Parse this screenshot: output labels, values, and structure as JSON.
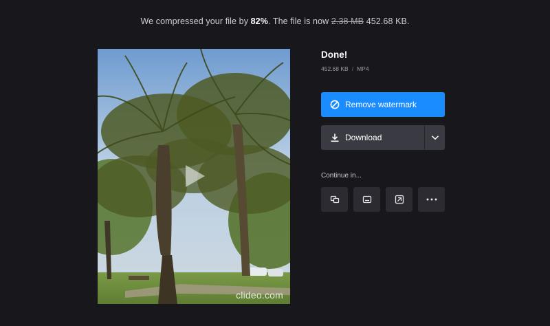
{
  "summary": {
    "prefix": "We compressed your file by ",
    "percent": "82%",
    "middle": ". The file is now ",
    "original_size": "2.38 MB",
    "new_size": "452.68 KB."
  },
  "preview": {
    "watermark": "clideo.com",
    "play_icon": "play-icon"
  },
  "result": {
    "title": "Done!",
    "size": "452.68 KB",
    "separator": "/",
    "format": "MP4"
  },
  "actions": {
    "remove_watermark_label": "Remove watermark",
    "remove_watermark_icon": "no-watermark-icon",
    "download_label": "Download",
    "download_icon": "download-icon",
    "download_more_icon": "chevron-down-icon"
  },
  "continue": {
    "label": "Continue in...",
    "tools": [
      {
        "icon": "merge-icon"
      },
      {
        "icon": "subtitles-icon"
      },
      {
        "icon": "resize-icon"
      },
      {
        "icon": "more-icon"
      }
    ]
  },
  "colors": {
    "background": "#17171c",
    "accent": "#1a8cff",
    "secondary_button": "#3a3a42",
    "tool_button": "#2b2b31"
  }
}
